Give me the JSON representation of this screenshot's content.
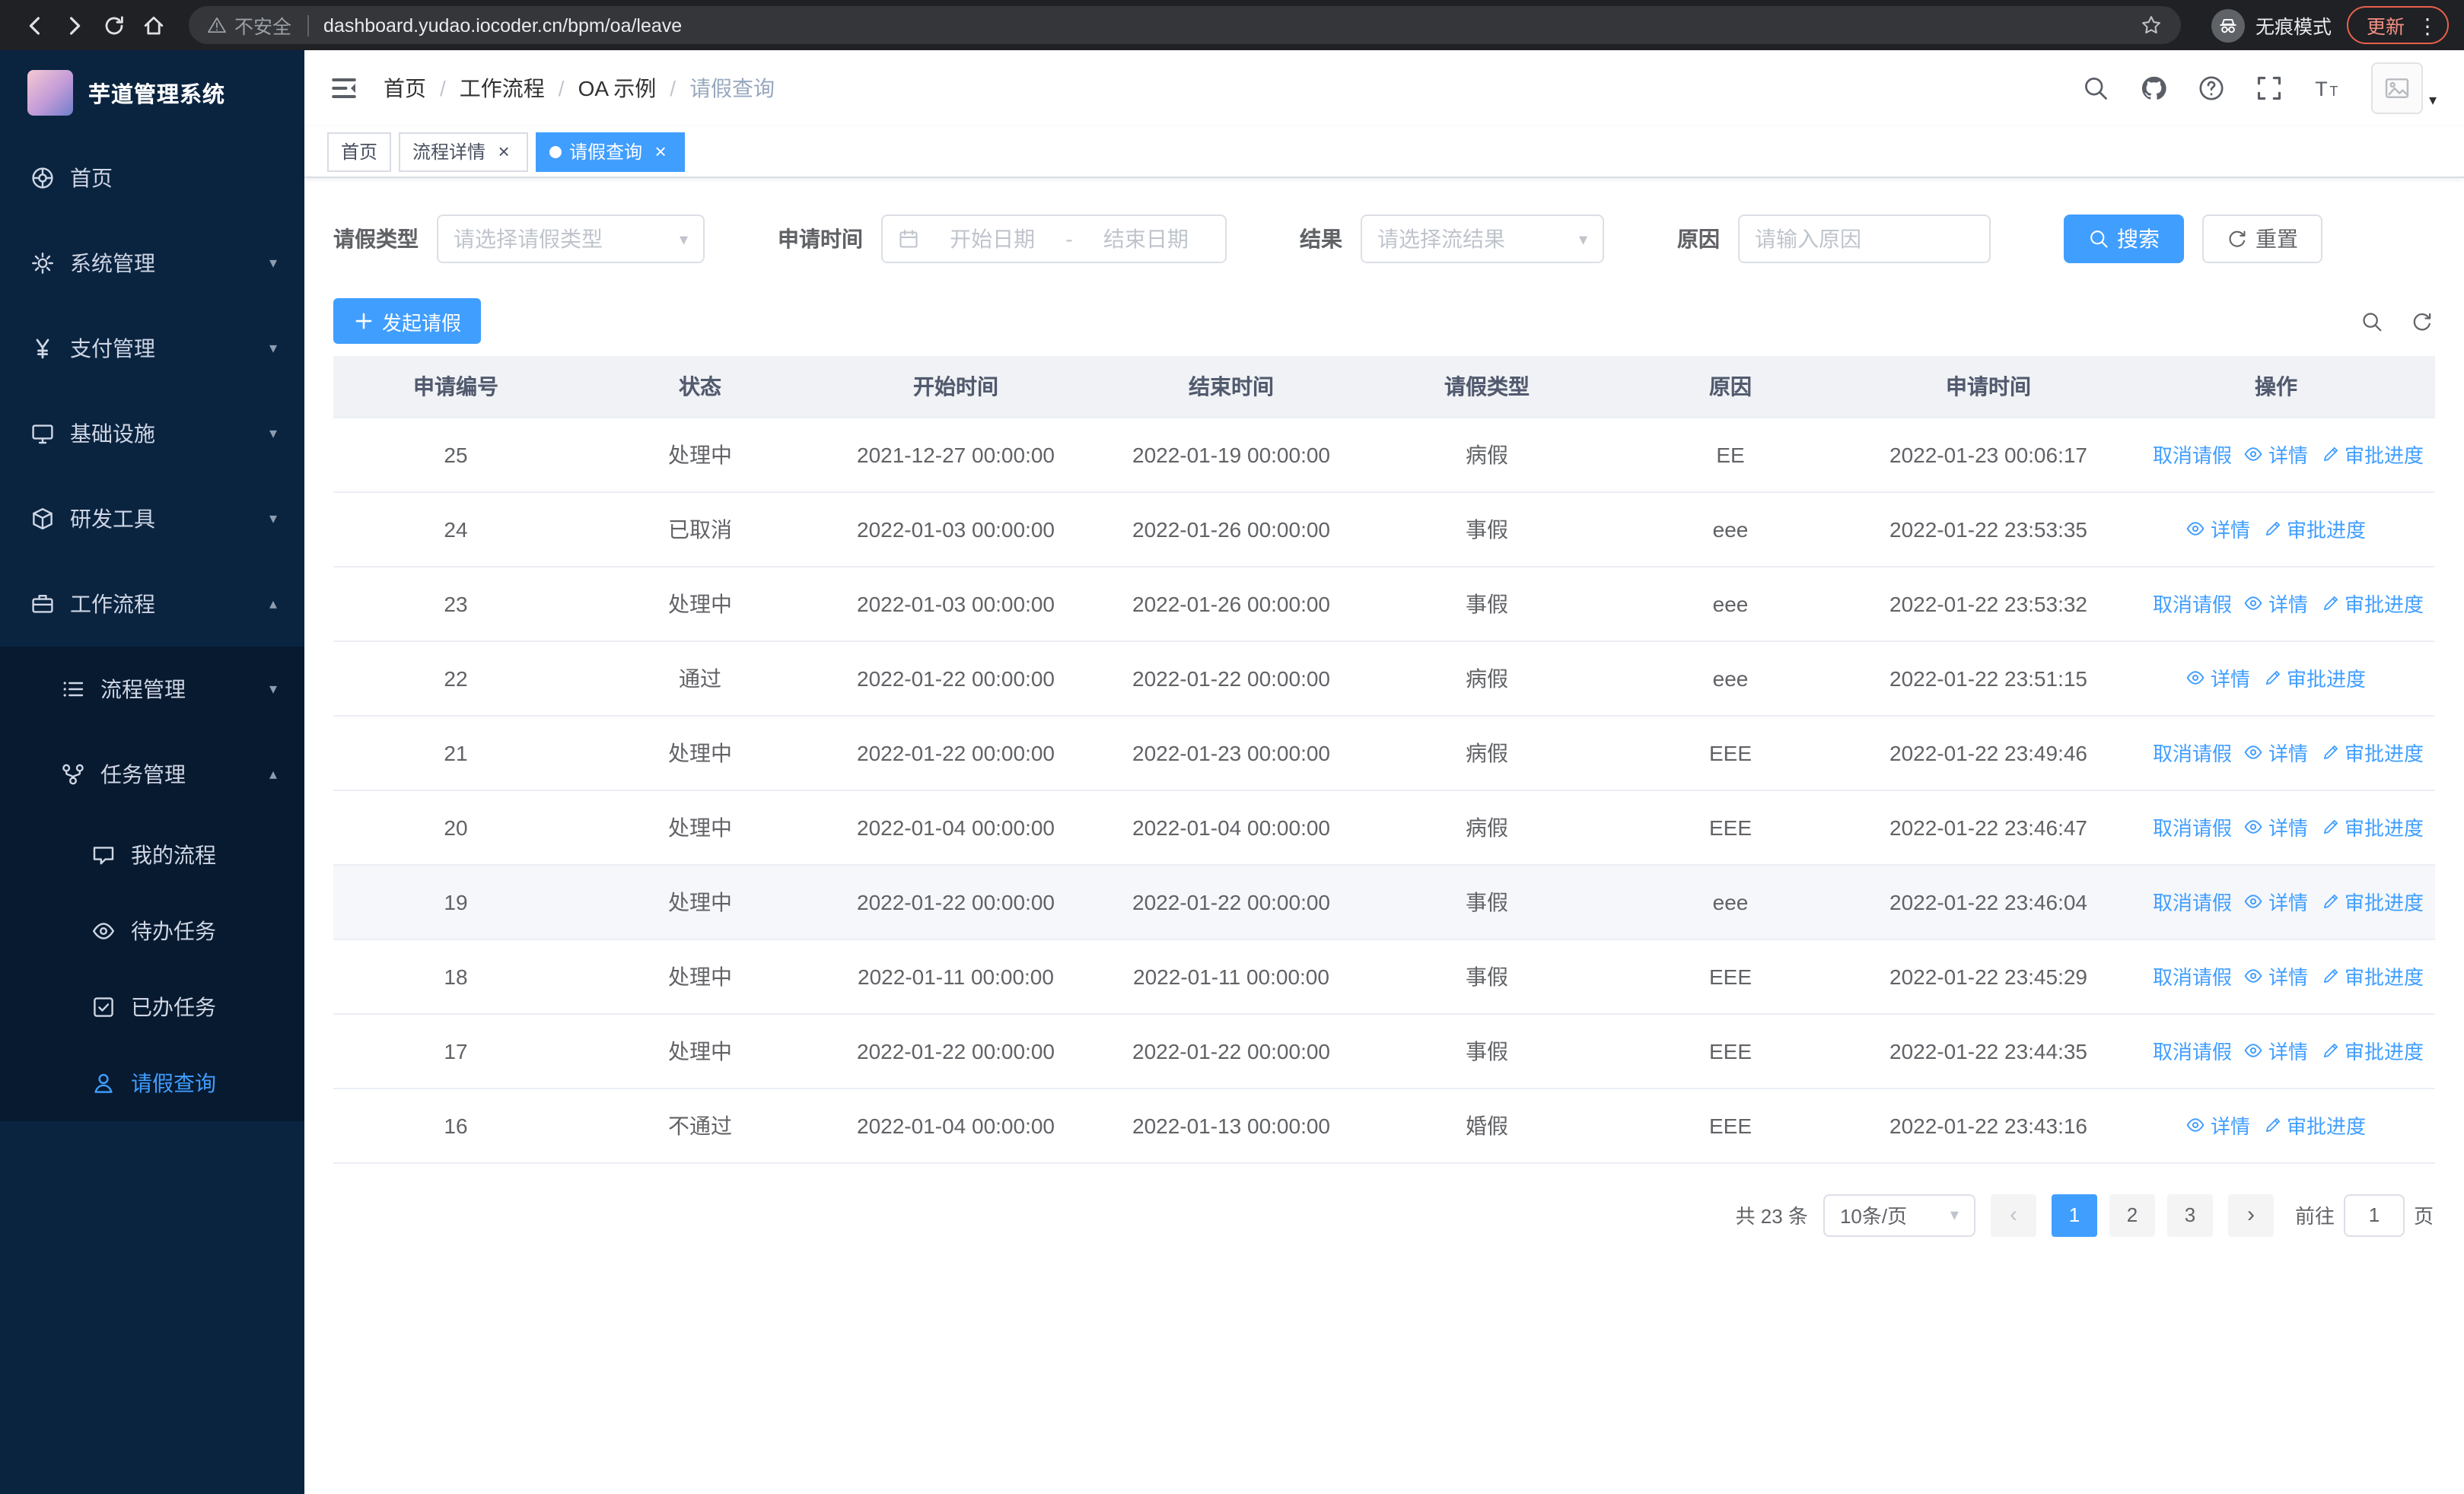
{
  "browser": {
    "security_label": "不安全",
    "url": "dashboard.yudao.iocoder.cn/bpm/oa/leave",
    "incognito_label": "无痕模式",
    "update_label": "更新"
  },
  "icons": {
    "chevron_down": "▾",
    "chevron_up": "▴",
    "close": "×",
    "more_menu": "⋮",
    "prev_page": "‹",
    "next_page": "›"
  },
  "theme": {
    "primary": "#409eff",
    "sidebar_bg": "#0a2440",
    "sidebar_submenu_bg": "#071a30",
    "chrome_bg": "#202124",
    "table_header_bg": "#f0f2f5",
    "link": "#409eff"
  },
  "sidebar": {
    "logo_title": "芋道管理系统",
    "items": [
      {
        "key": "home",
        "label": "首页",
        "icon": "dashboard",
        "level": 1,
        "expandable": false
      },
      {
        "key": "system-manage",
        "label": "系统管理",
        "icon": "gear",
        "level": 1,
        "expandable": true,
        "expanded": false
      },
      {
        "key": "payment-manage",
        "label": "支付管理",
        "icon": "yen",
        "level": 1,
        "expandable": true,
        "expanded": false
      },
      {
        "key": "infrastructure",
        "label": "基础设施",
        "icon": "monitor",
        "level": 1,
        "expandable": true,
        "expanded": false
      },
      {
        "key": "dev-tools",
        "label": "研发工具",
        "icon": "cube",
        "level": 1,
        "expandable": true,
        "expanded": false
      },
      {
        "key": "workflow",
        "label": "工作流程",
        "icon": "briefcase",
        "level": 1,
        "expandable": true,
        "expanded": true
      },
      {
        "key": "process-manage",
        "label": "流程管理",
        "icon": "list",
        "level": 2,
        "expandable": true,
        "expanded": false
      },
      {
        "key": "task-manage",
        "label": "任务管理",
        "icon": "nodes",
        "level": 2,
        "expandable": true,
        "expanded": true
      },
      {
        "key": "my-process",
        "label": "我的流程",
        "icon": "chat-bubble",
        "level": 3,
        "expandable": false
      },
      {
        "key": "todo-tasks",
        "label": "待办任务",
        "icon": "eye",
        "level": 3,
        "expandable": false
      },
      {
        "key": "done-tasks",
        "label": "已办任务",
        "icon": "check-square",
        "level": 3,
        "expandable": false
      },
      {
        "key": "leave-query",
        "label": "请假查询",
        "icon": "user",
        "level": 3,
        "expandable": false,
        "active": true
      }
    ]
  },
  "header": {
    "breadcrumb": [
      "首页",
      "工作流程",
      "OA 示例",
      "请假查询"
    ]
  },
  "tabs": [
    {
      "key": "home",
      "label": "首页",
      "closable": false,
      "active": false
    },
    {
      "key": "process-detail",
      "label": "流程详情",
      "closable": true,
      "active": false
    },
    {
      "key": "leave-query",
      "label": "请假查询",
      "closable": true,
      "active": true
    }
  ],
  "filters": {
    "leave_type_label": "请假类型",
    "leave_type_placeholder": "请选择请假类型",
    "apply_time_label": "申请时间",
    "date_start_placeholder": "开始日期",
    "date_separator": "-",
    "date_end_placeholder": "结束日期",
    "result_label": "结果",
    "result_placeholder": "请选择流结果",
    "reason_label": "原因",
    "reason_placeholder": "请输入原因",
    "search_button": "搜索",
    "reset_button": "重置"
  },
  "toolbar": {
    "create_button": "发起请假"
  },
  "table": {
    "columns": [
      "申请编号",
      "状态",
      "开始时间",
      "结束时间",
      "请假类型",
      "原因",
      "申请时间",
      "操作"
    ],
    "action_labels": {
      "cancel": "取消请假",
      "detail": "详情",
      "progress": "审批进度"
    },
    "hovered_row_id": "19",
    "rows": [
      {
        "id": "25",
        "status": "处理中",
        "start": "2021-12-27 00:00:00",
        "end": "2022-01-19 00:00:00",
        "type": "病假",
        "reason": "EE",
        "apply_time": "2022-01-23 00:06:17",
        "actions": [
          "cancel",
          "detail",
          "progress"
        ]
      },
      {
        "id": "24",
        "status": "已取消",
        "start": "2022-01-03 00:00:00",
        "end": "2022-01-26 00:00:00",
        "type": "事假",
        "reason": "eee",
        "apply_time": "2022-01-22 23:53:35",
        "actions": [
          "detail",
          "progress"
        ]
      },
      {
        "id": "23",
        "status": "处理中",
        "start": "2022-01-03 00:00:00",
        "end": "2022-01-26 00:00:00",
        "type": "事假",
        "reason": "eee",
        "apply_time": "2022-01-22 23:53:32",
        "actions": [
          "cancel",
          "detail",
          "progress"
        ]
      },
      {
        "id": "22",
        "status": "通过",
        "start": "2022-01-22 00:00:00",
        "end": "2022-01-22 00:00:00",
        "type": "病假",
        "reason": "eee",
        "apply_time": "2022-01-22 23:51:15",
        "actions": [
          "detail",
          "progress"
        ]
      },
      {
        "id": "21",
        "status": "处理中",
        "start": "2022-01-22 00:00:00",
        "end": "2022-01-23 00:00:00",
        "type": "病假",
        "reason": "EEE",
        "apply_time": "2022-01-22 23:49:46",
        "actions": [
          "cancel",
          "detail",
          "progress"
        ]
      },
      {
        "id": "20",
        "status": "处理中",
        "start": "2022-01-04 00:00:00",
        "end": "2022-01-04 00:00:00",
        "type": "病假",
        "reason": "EEE",
        "apply_time": "2022-01-22 23:46:47",
        "actions": [
          "cancel",
          "detail",
          "progress"
        ]
      },
      {
        "id": "19",
        "status": "处理中",
        "start": "2022-01-22 00:00:00",
        "end": "2022-01-22 00:00:00",
        "type": "事假",
        "reason": "eee",
        "apply_time": "2022-01-22 23:46:04",
        "actions": [
          "cancel",
          "detail",
          "progress"
        ]
      },
      {
        "id": "18",
        "status": "处理中",
        "start": "2022-01-11 00:00:00",
        "end": "2022-01-11 00:00:00",
        "type": "事假",
        "reason": "EEE",
        "apply_time": "2022-01-22 23:45:29",
        "actions": [
          "cancel",
          "detail",
          "progress"
        ]
      },
      {
        "id": "17",
        "status": "处理中",
        "start": "2022-01-22 00:00:00",
        "end": "2022-01-22 00:00:00",
        "type": "事假",
        "reason": "EEE",
        "apply_time": "2022-01-22 23:44:35",
        "actions": [
          "cancel",
          "detail",
          "progress"
        ]
      },
      {
        "id": "16",
        "status": "不通过",
        "start": "2022-01-04 00:00:00",
        "end": "2022-01-13 00:00:00",
        "type": "婚假",
        "reason": "EEE",
        "apply_time": "2022-01-22 23:43:16",
        "actions": [
          "detail",
          "progress"
        ]
      }
    ]
  },
  "pagination": {
    "total_label": "共 23 条",
    "page_size": "10条/页",
    "pages": [
      "1",
      "2",
      "3"
    ],
    "active_page": "1",
    "goto_label": "前往",
    "goto_value": "1",
    "goto_suffix": "页"
  }
}
